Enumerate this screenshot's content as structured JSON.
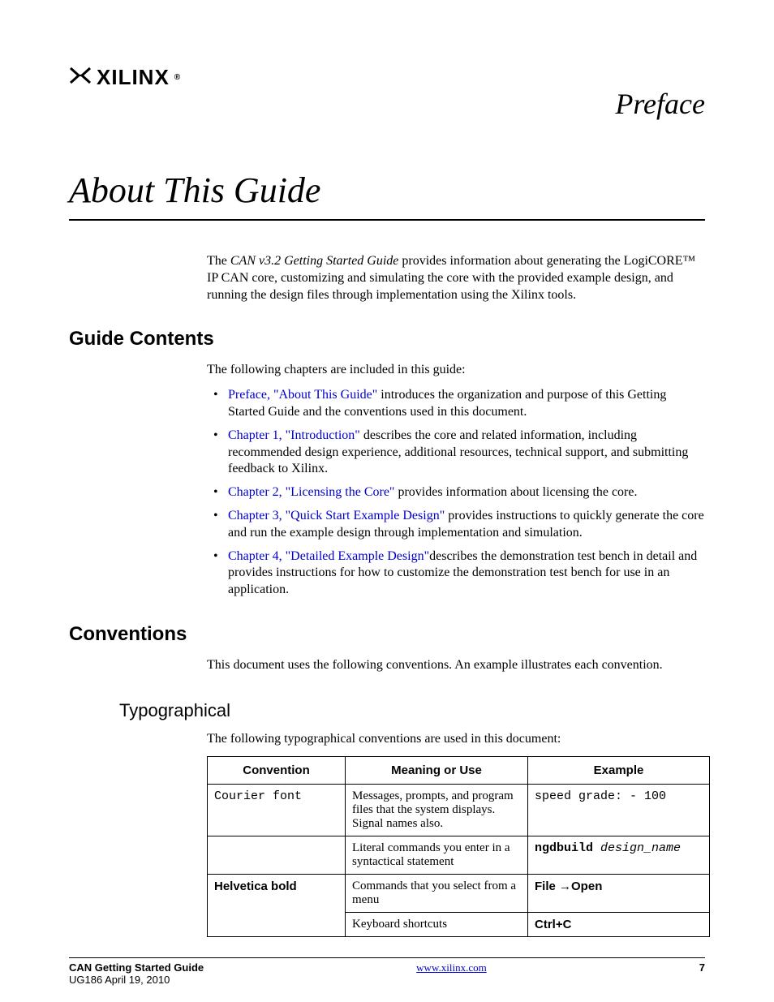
{
  "header": {
    "logo_text": "XILINX",
    "preface": "Preface"
  },
  "title": "About This Guide",
  "intro": {
    "line1_prefix": "The ",
    "line1_italic": "CAN v3.2 Getting Started Guide",
    "line1_rest": " provides information about generating the LogiCORE™ IP CAN core, customizing and simulating the core with the provided example design, and running the design files through implementation using the Xilinx tools."
  },
  "sections": {
    "guide_contents": {
      "heading": "Guide Contents",
      "lead": "The following chapters are included in this guide:",
      "items": [
        {
          "link": "Preface, \"About This Guide\"",
          "rest": " introduces the organization and purpose of this Getting Started Guide and the conventions used in this document."
        },
        {
          "link": "Chapter 1, \"Introduction\"",
          "rest": " describes the core and related information, including recommended design experience, additional resources, technical support, and submitting feedback to Xilinx."
        },
        {
          "link": "Chapter 2, \"Licensing the Core\"",
          "rest": " provides information about licensing the core."
        },
        {
          "link": "Chapter 3, \"Quick Start Example Design\"",
          "rest": " provides instructions to quickly generate the core and run the example design through implementation and simulation."
        },
        {
          "link": "Chapter 4, \"Detailed Example Design\"",
          "rest": "describes the demonstration test bench in detail and provides instructions for how to customize the demonstration test bench for use in an application."
        }
      ]
    },
    "conventions": {
      "heading": "Conventions",
      "lead": "This document uses the following conventions. An example illustrates each convention.",
      "typographical": {
        "heading": "Typographical",
        "lead": "The following typographical conventions are used in this document:",
        "headers": {
          "c1": "Convention",
          "c2": "Meaning or Use",
          "c3": "Example"
        },
        "rows": {
          "r1": {
            "conv": "Courier font",
            "mean": "Messages, prompts, and program files that the system displays. Signal names also.",
            "ex": "speed grade: - 100"
          },
          "r2": {
            "conv": "",
            "mean": "Literal commands you enter in a syntactical statement",
            "ex_bold": "ngdbuild",
            "ex_ital": " design_name"
          },
          "r3a": {
            "conv": "Helvetica bold",
            "mean": "Commands that you select from a menu",
            "ex_pre": "File ",
            "ex_arrow": "→",
            "ex_post": "Open"
          },
          "r3b": {
            "mean": "Keyboard shortcuts",
            "ex": "Ctrl+C"
          }
        }
      }
    }
  },
  "footer": {
    "title": "CAN Getting Started Guide",
    "sub": "UG186 April 19, 2010",
    "url": "www.xilinx.com",
    "page": "7"
  }
}
